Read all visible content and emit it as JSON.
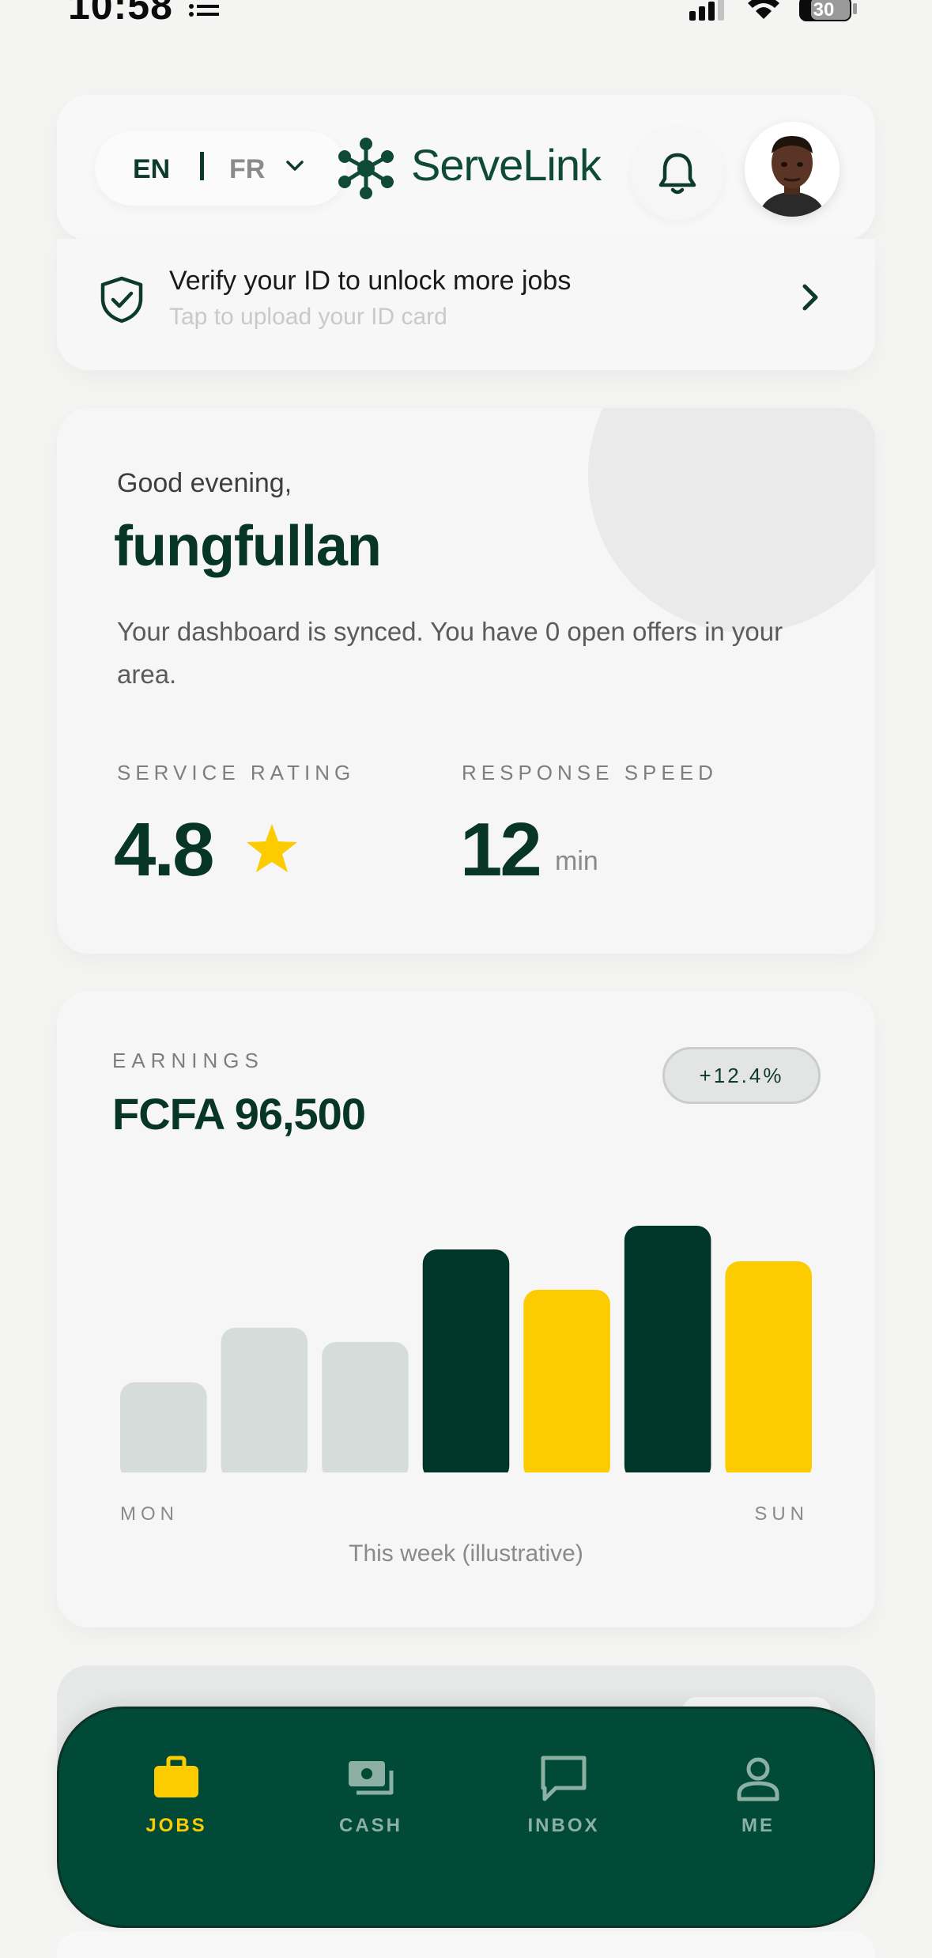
{
  "status_bar": {
    "time": "10:58",
    "battery": "30"
  },
  "header": {
    "lang_en": "EN",
    "lang_fr": "FR",
    "brand": "ServeLink"
  },
  "verify": {
    "title": "Verify your ID to unlock more jobs",
    "subtitle": "Tap to upload your ID card"
  },
  "greeting": {
    "hello": "Good evening,",
    "name": "fungfullan",
    "message": "Your dashboard is synced. You have 0 open offers in your area.",
    "rating_label": "SERVICE RATING",
    "rating_value": "4.8",
    "speed_label": "RESPONSE SPEED",
    "speed_value": "12",
    "speed_unit": "min"
  },
  "earnings": {
    "label": "EARNINGS",
    "amount": "FCFA 96,500",
    "change": "+12.4%",
    "caption": "This week (illustrative)"
  },
  "chart_data": {
    "type": "bar",
    "categories": [
      "MON",
      "",
      "",
      "",
      "",
      "",
      "SUN"
    ],
    "x_tick_labels": [
      "MON",
      "SUN"
    ],
    "values": [
      38,
      61,
      55,
      94,
      77,
      104,
      89
    ],
    "bar_colors": [
      "#d6dcda",
      "#d6dcda",
      "#d6dcda",
      "#00352a",
      "#fccc00",
      "#00352a",
      "#fccc00"
    ],
    "ylim": [
      0,
      110
    ],
    "grid": false
  },
  "nav": {
    "items": [
      {
        "label": "JOBS",
        "icon": "briefcase-icon",
        "active": true
      },
      {
        "label": "CASH",
        "icon": "cash-icon",
        "active": false
      },
      {
        "label": "INBOX",
        "icon": "chat-icon",
        "active": false
      },
      {
        "label": "ME",
        "icon": "person-icon",
        "active": false
      }
    ]
  },
  "colors": {
    "brand": "#0e4a35",
    "accent": "#fccc00",
    "nav_bg": "#004a37"
  }
}
